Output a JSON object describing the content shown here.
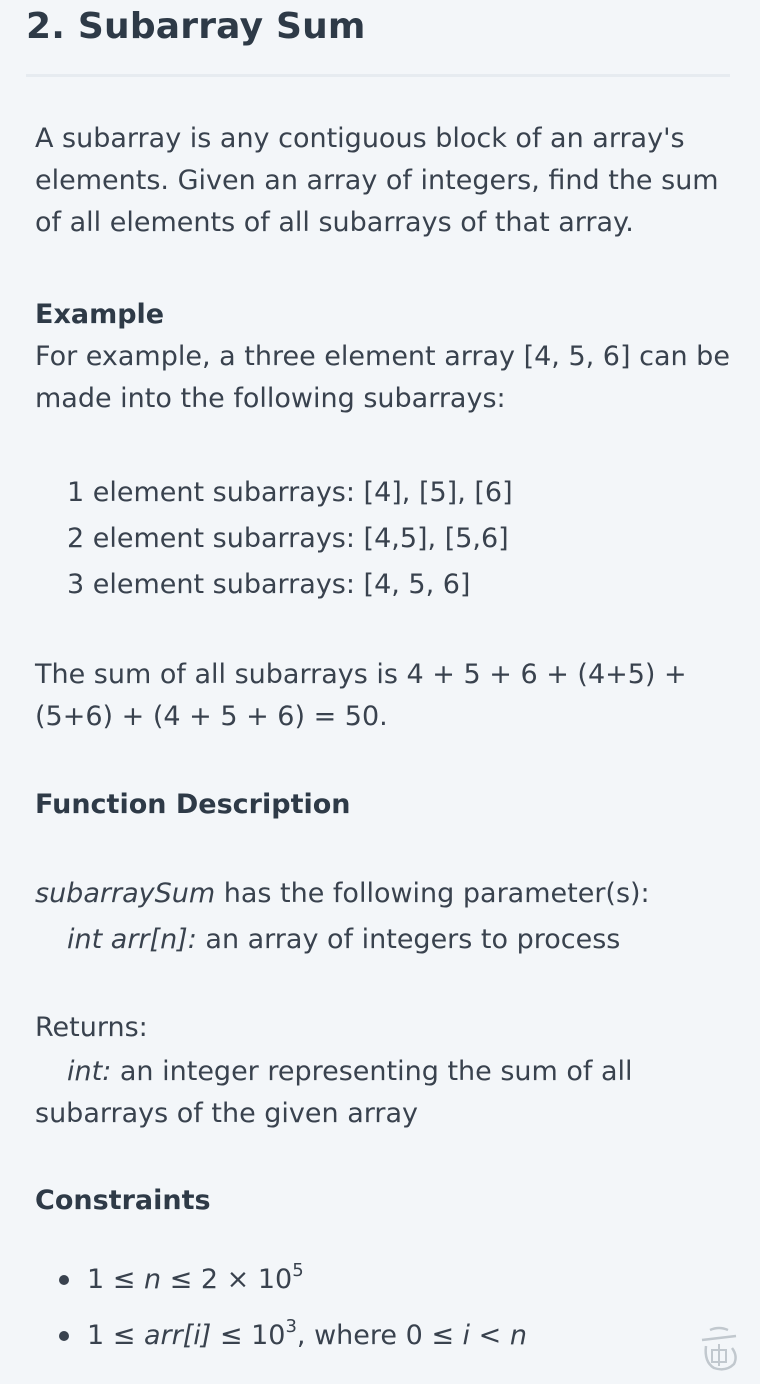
{
  "title": "2. Subarray Sum",
  "intro": "A subarray is any contiguous block of an array's elements. Given an array of integers, find the sum of all elements of all subarrays of that array.",
  "example": {
    "heading": "Example",
    "text": "For example, a three element array [4, 5, 6] can be made into the following subarrays:",
    "subarrays": [
      "1 element subarrays: [4], [5], [6]",
      "2 element subarrays: [4,5], [5,6]",
      "3 element subarrays: [4, 5, 6]"
    ],
    "sum_text": "The sum of all subarrays is 4 + 5 + 6 + (4+5) + (5+6) + (4 + 5 + 6) = 50."
  },
  "function_description": {
    "heading": "Function Description",
    "function_name": "subarraySum",
    "params_intro": " has the following parameter(s):",
    "param_name": "int arr[n]:",
    "param_desc": " an array of integers to process",
    "returns_label": "Returns:",
    "return_type": "int:",
    "return_desc": " an integer representing the sum of all subarrays of the given array"
  },
  "constraints": {
    "heading": "Constraints",
    "c1": {
      "a": "1 ≤ ",
      "var": "n",
      "b": " ≤ 2 × 10",
      "exp": "5"
    },
    "c2": {
      "a": "1 ≤ ",
      "var": "arr[i]",
      "b": " ≤ 10",
      "exp": "3",
      "c": ", where 0 ≤ ",
      "var2": "i",
      "d": " < ",
      "var3": "n"
    }
  },
  "watermark_icon": "watermark-logo-icon"
}
